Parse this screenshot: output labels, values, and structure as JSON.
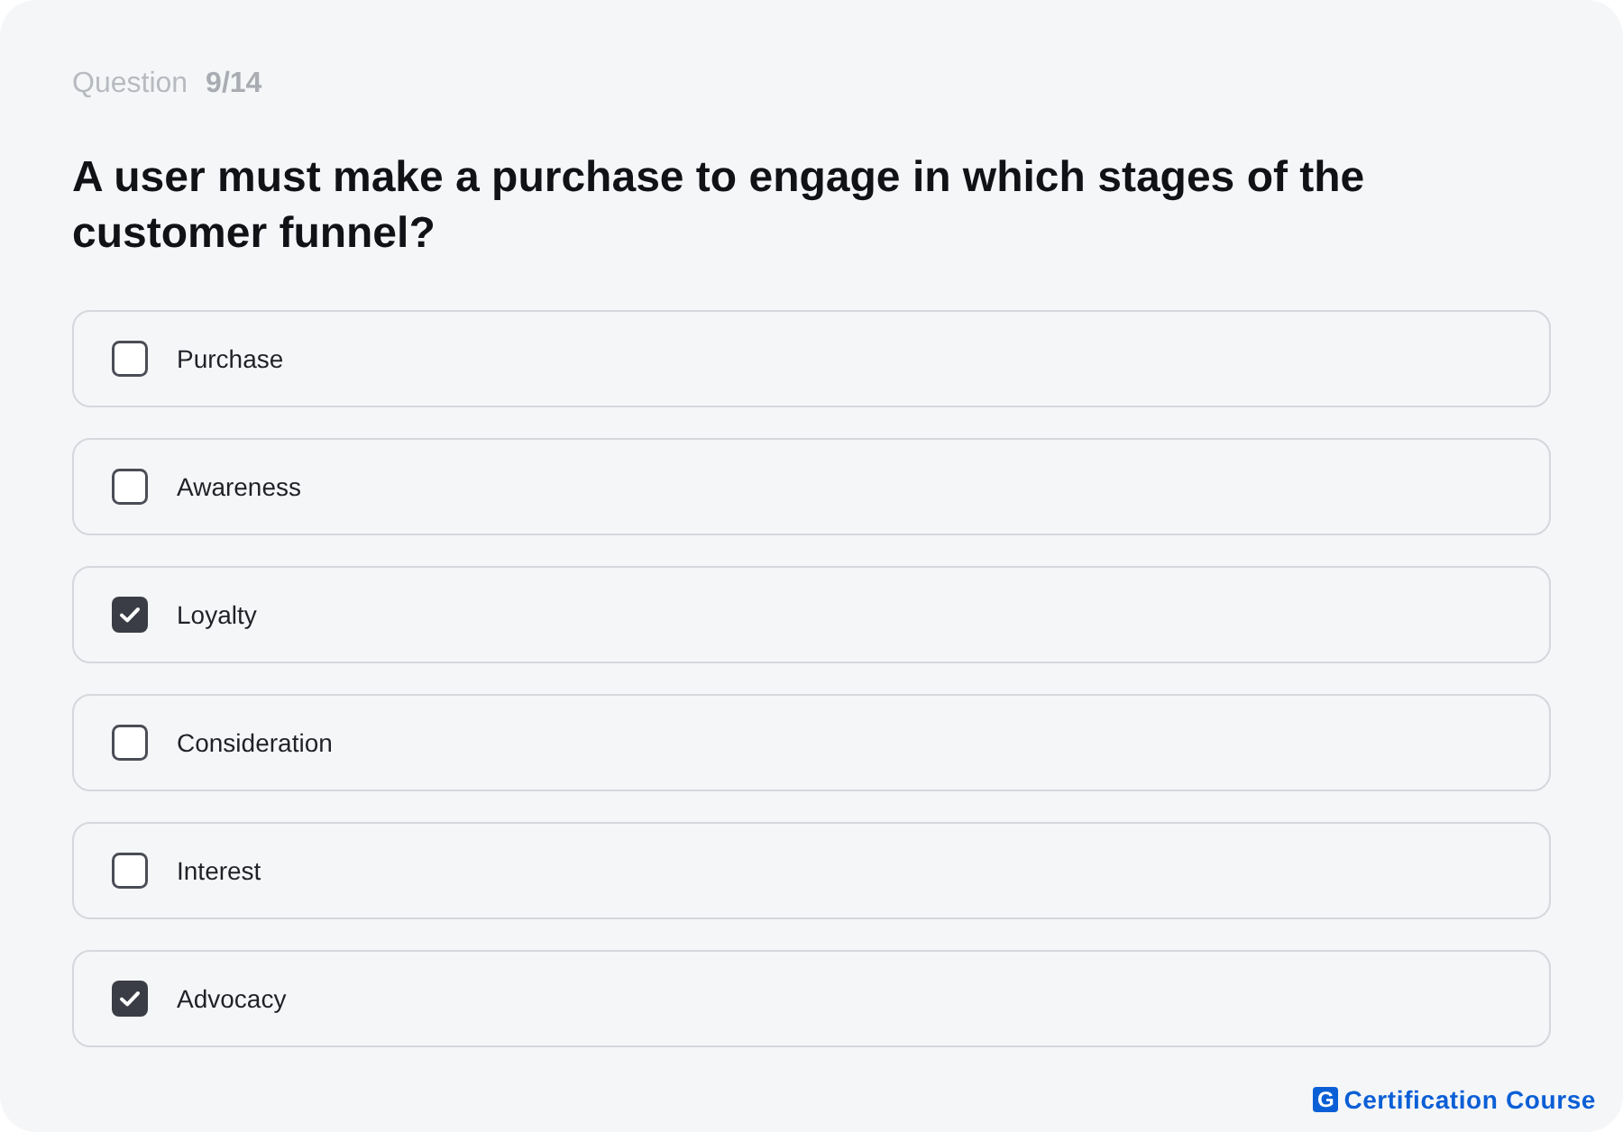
{
  "header": {
    "label": "Question",
    "number": "9/14"
  },
  "question": "A user must make a purchase to engage in which stages of the customer funnel?",
  "options": [
    {
      "label": "Purchase",
      "checked": false
    },
    {
      "label": "Awareness",
      "checked": false
    },
    {
      "label": "Loyalty",
      "checked": true
    },
    {
      "label": "Consideration",
      "checked": false
    },
    {
      "label": "Interest",
      "checked": false
    },
    {
      "label": "Advocacy",
      "checked": true
    }
  ],
  "footer": {
    "logo_mark": "G",
    "brand": "Certification Course"
  }
}
